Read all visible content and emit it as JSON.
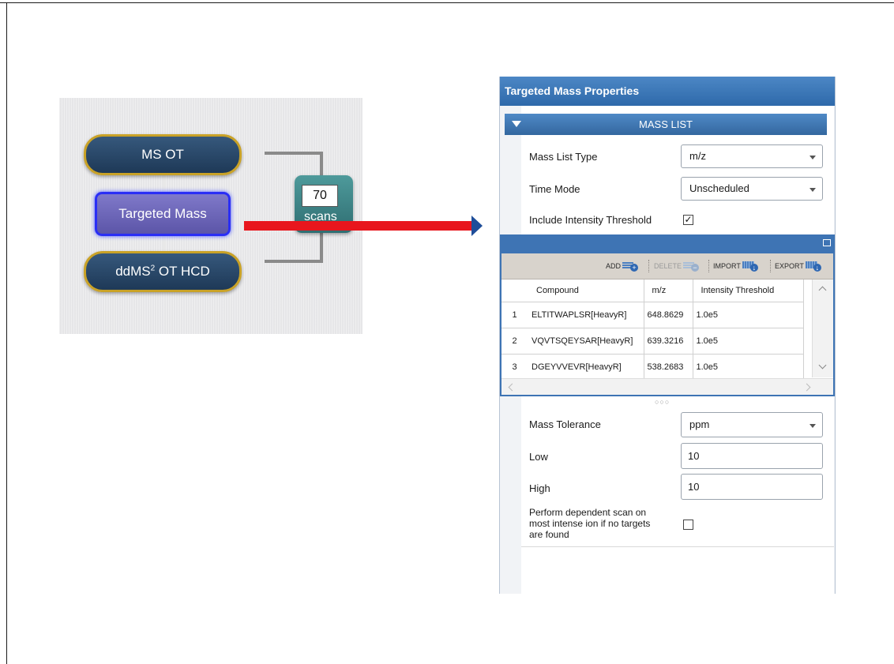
{
  "method_tree": {
    "nodes": {
      "ms_ot": "MS OT",
      "targeted_mass": "Targeted Mass",
      "ddms2_prefix": "ddMS",
      "ddms2_sup": "2",
      "ddms2_suffix": " OT HCD"
    },
    "scans": {
      "count": "70",
      "label": "scans"
    }
  },
  "colors": {
    "arrow_shaft": "#e8161d",
    "arrow_head": "#1f4e9a",
    "pill_fill": "#1e3957",
    "pill_border": "#c9a227",
    "selected_node": "#5c55a8",
    "panel_header": "#3e74b4"
  },
  "properties": {
    "title": "Targeted Mass Properties",
    "section": "MASS LIST",
    "mass_list_type": {
      "label": "Mass List Type",
      "value": "m/z"
    },
    "time_mode": {
      "label": "Time Mode",
      "value": "Unscheduled"
    },
    "intensity_threshold": {
      "label": "Include Intensity Threshold",
      "checked": true,
      "mark": "✓"
    },
    "toolbar": {
      "add": "ADD",
      "delete": "DELETE",
      "import": "IMPORT",
      "export": "EXPORT"
    },
    "table": {
      "columns": [
        "",
        "Compound",
        "m/z",
        "Intensity Threshold"
      ],
      "rows": [
        {
          "index": "1",
          "compound": "ELTITWAPLSR[HeavyR]",
          "mz": "648.8629",
          "threshold": "1.0e5"
        },
        {
          "index": "2",
          "compound": "VQVTSQEYSAR[HeavyR]",
          "mz": "639.3216",
          "threshold": "1.0e5"
        },
        {
          "index": "3",
          "compound": "DGEYVVEVR[HeavyR]",
          "mz": "538.2683",
          "threshold": "1.0e5"
        }
      ]
    },
    "mass_tolerance": {
      "label": "Mass Tolerance",
      "value": "ppm"
    },
    "low": {
      "label": "Low",
      "value": "10"
    },
    "high": {
      "label": "High",
      "value": "10"
    },
    "dependent_scan": {
      "label_line1": "Perform dependent scan on",
      "label_line2": "most intense ion if no targets",
      "label_line3": "are found",
      "checked": false
    }
  }
}
